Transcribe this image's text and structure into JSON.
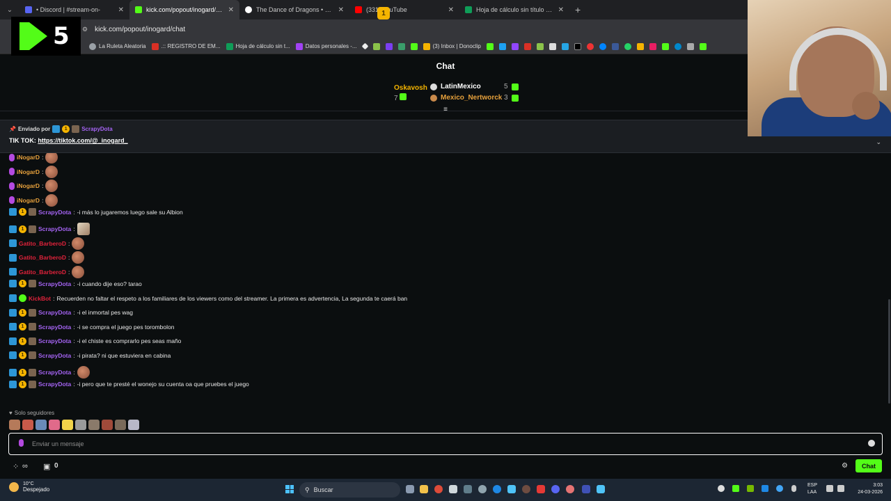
{
  "browser": {
    "tabs": [
      {
        "title": "• Discord | #stream-on-",
        "color": "#5865f2",
        "active": false
      },
      {
        "title": "kick.com/popout/inogard/chat",
        "color": "#53fc18",
        "active": true
      },
      {
        "title": "The Dance of Dragons • HBO M",
        "color": "#ffffff",
        "active": false
      },
      {
        "title": "(331) YouTube",
        "color": "#ff0000",
        "active": false
      },
      {
        "title": "Hoja de cálculo sin título - Hoja",
        "color": "#0f9d58",
        "active": false
      }
    ],
    "url": "kick.com/popout/inogard/chat",
    "bookmarks": [
      {
        "label": "La Ruleta Aleatoria",
        "color": "#9aa0a6"
      },
      {
        "label": ".:: REGISTRO DE EM...",
        "color": "#d93025"
      },
      {
        "label": "Hoja de cálculo sin t...",
        "color": "#0f9d58"
      },
      {
        "label": "Datos personales -...",
        "color": "#a142f4"
      },
      {
        "label": "(3) Inbox | Donoclip",
        "color": "#f5b400"
      }
    ]
  },
  "overlay": {
    "logo_number": "5"
  },
  "chat": {
    "header": "Chat",
    "leaderboard": {
      "first": {
        "rank": "1",
        "name": "Oskavosh",
        "count": "7"
      },
      "second": {
        "name": "LatinMexico",
        "count": "5"
      },
      "third": {
        "name": "Mexico_Nertworck",
        "count": "3"
      }
    },
    "pinned": {
      "sent_by_label": "Enviado por",
      "user": "ScrapyDota",
      "text_prefix": "TIK TOK: ",
      "link": "https://tiktok.com/@_inogard_"
    },
    "messages": [
      {
        "user": "iNogarD",
        "text": "",
        "emote": true,
        "type": "inogard"
      },
      {
        "user": "iNogarD",
        "text": "",
        "emote": true,
        "type": "inogard"
      },
      {
        "user": "iNogarD",
        "text": "",
        "emote": true,
        "type": "inogard"
      },
      {
        "user": "iNogarD",
        "text": "",
        "emote": true,
        "type": "inogard"
      },
      {
        "user": "ScrapyDota",
        "text": "-i más lo jugaremos luego sale su Albion",
        "emote": false,
        "type": "scrapy"
      },
      {
        "user": "ScrapyDota",
        "text": "",
        "emote": true,
        "type": "scrapy"
      },
      {
        "user": "Gatito_BarberoD",
        "text": "",
        "emote": true,
        "type": "gatito"
      },
      {
        "user": "Gatito_BarberoD",
        "text": "",
        "emote": true,
        "type": "gatito"
      },
      {
        "user": "Gatito_BarberoD",
        "text": "",
        "emote": true,
        "type": "gatito"
      },
      {
        "user": "ScrapyDota",
        "text": "-i cuando dije eso? tarao",
        "emote": false,
        "type": "scrapy"
      },
      {
        "user": "KickBot",
        "text": "Recuerden no faltar el respeto a los familiares de los viewers como del streamer. La primera es advertencia, La segunda te caerá ban",
        "emote": false,
        "type": "bot"
      },
      {
        "user": "ScrapyDota",
        "text": "-i el inmortal pes wag",
        "emote": false,
        "type": "scrapy"
      },
      {
        "user": "ScrapyDota",
        "text": "-i se compra el juego pes torombolon",
        "emote": false,
        "type": "scrapy"
      },
      {
        "user": "ScrapyDota",
        "text": "-i el chiste es comprarlo pes seas maño",
        "emote": false,
        "type": "scrapy"
      },
      {
        "user": "ScrapyDota",
        "text": "-i pirata? ni que estuviera en cabina",
        "emote": false,
        "type": "scrapy"
      },
      {
        "user": "ScrapyDota",
        "text": "",
        "emote": true,
        "type": "scrapy"
      },
      {
        "user": "ScrapyDota",
        "text": "-i pero que te presté el wonejo su cuenta oa que pruebes el juego",
        "emote": false,
        "type": "scrapy"
      }
    ],
    "followers_only": "Solo seguidores",
    "input_placeholder": "Enviar un mensaje",
    "footer_count": "0",
    "chat_button": "Chat"
  },
  "taskbar": {
    "weather_temp": "10°C",
    "weather_desc": "Despejado",
    "search_label": "Buscar",
    "lang_1": "ESP",
    "lang_2": "LAA",
    "time": "3:03",
    "date": "24-03-2026"
  },
  "colors": {
    "accent": "#53fc18",
    "scrapy": "#a463f2",
    "inogard": "#e7a13c",
    "gatito": "#e0223b"
  }
}
